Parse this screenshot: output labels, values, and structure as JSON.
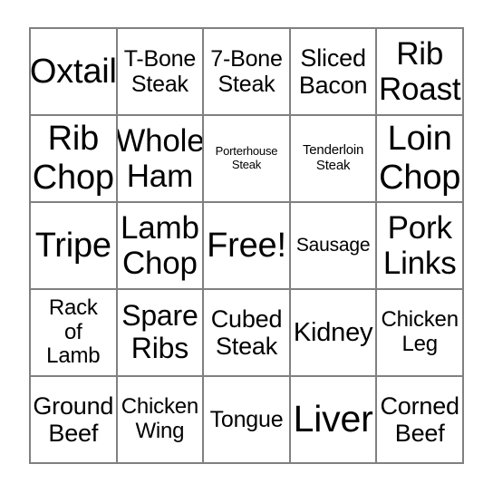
{
  "card": {
    "type": "bingo-card",
    "columns": 5,
    "rows": 5,
    "border_color": "#808080",
    "background_color": "#ffffff",
    "text_color": "#000000",
    "free_space": "Free!",
    "cells": [
      {
        "label": "Oxtail",
        "size": "fs-4xl"
      },
      {
        "label": "T-Bone\nSteak",
        "size": "fs-ml"
      },
      {
        "label": "7-Bone\nSteak",
        "size": "fs-ml"
      },
      {
        "label": "Sliced\nBacon",
        "size": "fs-l"
      },
      {
        "label": "Rib\nRoast",
        "size": "fs-3xl"
      },
      {
        "label": "Rib\nChop",
        "size": "fs-4xl"
      },
      {
        "label": "Whole\nHam",
        "size": "fs-3xl"
      },
      {
        "label": "Porterhouse\nSteak",
        "size": "fs-xxs"
      },
      {
        "label": "Tenderloin\nSteak",
        "size": "fs-xs"
      },
      {
        "label": "Loin\nChop",
        "size": "fs-4xl"
      },
      {
        "label": "Tripe",
        "size": "fs-4xl"
      },
      {
        "label": "Lamb\nChop",
        "size": "fs-3xl"
      },
      {
        "label": "Free!",
        "size": "fs-4xl"
      },
      {
        "label": "Sausage",
        "size": "fs-s"
      },
      {
        "label": "Pork\nLinks",
        "size": "fs-3xl"
      },
      {
        "label": "Rack\nof\nLamb",
        "size": "fs-m"
      },
      {
        "label": "Spare\nRibs",
        "size": "fs-2xl"
      },
      {
        "label": "Cubed\nSteak",
        "size": "fs-l"
      },
      {
        "label": "Kidney",
        "size": "fs-xl"
      },
      {
        "label": "Chicken\nLeg",
        "size": "fs-m"
      },
      {
        "label": "Ground\nBeef",
        "size": "fs-l"
      },
      {
        "label": "Chicken\nWing",
        "size": "fs-m"
      },
      {
        "label": "Tongue",
        "size": "fs-ml"
      },
      {
        "label": "Liver",
        "size": "fs-5xl"
      },
      {
        "label": "Corned\nBeef",
        "size": "fs-l"
      }
    ]
  }
}
